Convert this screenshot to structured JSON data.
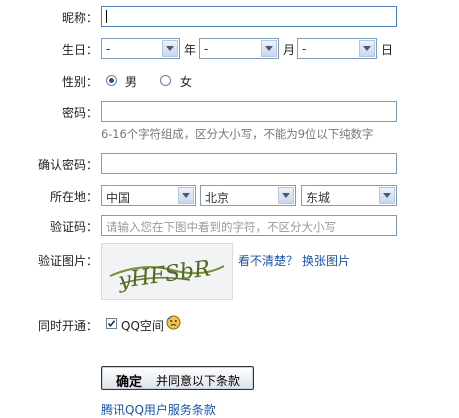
{
  "form": {
    "nickname": {
      "label": "昵称：",
      "value": ""
    },
    "birthday": {
      "label": "生日：",
      "year_value": "-",
      "year_unit": "年",
      "month_value": "-",
      "month_unit": "月",
      "day_value": "-",
      "day_unit": "日"
    },
    "gender": {
      "label": "性别：",
      "options": [
        "男",
        "女"
      ],
      "selected": "男"
    },
    "password": {
      "label": "密码：",
      "value": "",
      "hint": "6-16个字符组成，区分大小写，不能为9位以下纯数字"
    },
    "confirm_password": {
      "label": "确认密码：",
      "value": ""
    },
    "location": {
      "label": "所在地：",
      "country": "中国",
      "province": "北京",
      "district": "东城"
    },
    "verify_code": {
      "label": "验证码：",
      "placeholder": "请输入您在下图中看到的字符，不区分大小写"
    },
    "verify_image": {
      "label": "验证图片：",
      "captcha_text": "yHFSbR",
      "unclear_link": "看不清楚？",
      "change_link": "换张图片"
    },
    "also_open": {
      "label": "同时开通：",
      "option": "QQ空间",
      "checked": true
    },
    "submit": {
      "strong": "确定",
      "rest": "并同意以下条款"
    },
    "terms_link": "腾讯QQ用户服务条款"
  }
}
